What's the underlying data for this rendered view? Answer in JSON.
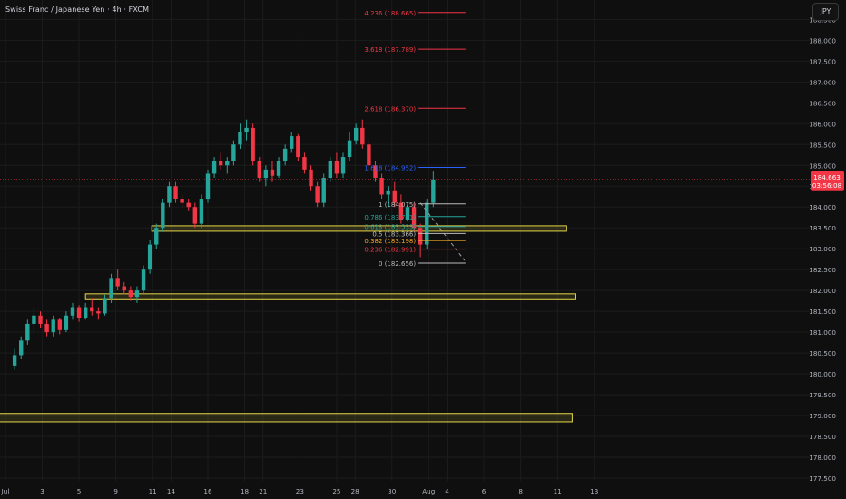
{
  "header": {
    "title": "Swiss Franc / Japanese Yen · 4h · FXCM",
    "currency_button": "JPY"
  },
  "price_tag": {
    "price": "184.663",
    "countdown": "03:56:08",
    "color": "#f23645"
  },
  "colors": {
    "bull": "#26a69a",
    "bear": "#f23645",
    "zone": "#e6d84a",
    "fib_ext": "#f23645",
    "fib_blue": "#2962ff"
  },
  "chart_data": {
    "type": "candlestick",
    "y_axis": {
      "range": [
        177.5,
        188.9
      ],
      "tick_labels": [
        "188.500",
        "188.000",
        "187.500",
        "187.000",
        "186.500",
        "186.000",
        "185.500",
        "185.000",
        "184.500",
        "184.000",
        "183.500",
        "183.000",
        "182.500",
        "182.000",
        "181.500",
        "181.000",
        "180.500",
        "180.000",
        "179.500",
        "179.000",
        "178.500",
        "178.000",
        "177.500"
      ],
      "ticks": [
        188.5,
        188.0,
        187.5,
        187.0,
        186.5,
        186.0,
        185.5,
        185.0,
        184.5,
        184.0,
        183.5,
        183.0,
        182.5,
        182.0,
        181.5,
        181.0,
        180.5,
        180.0,
        179.5,
        179.0,
        178.5,
        178.0,
        177.5
      ]
    },
    "x_axis": {
      "range": [
        1,
        45
      ],
      "tick_labels": [
        "Jul",
        "3",
        "5",
        "9",
        "11",
        "14",
        "16",
        "18",
        "21",
        "23",
        "25",
        "28",
        "30",
        "Aug",
        "4",
        "6",
        "8",
        "11",
        "13"
      ],
      "ticks": [
        1,
        3,
        5,
        7,
        9,
        10,
        12,
        14,
        15,
        17,
        19,
        20,
        22,
        24,
        25,
        27,
        29,
        31,
        33
      ]
    },
    "zones": [
      {
        "x": [
          8.95,
          31.5
        ],
        "y": [
          183.45,
          183.55
        ]
      },
      {
        "x": [
          5.35,
          32.0
        ],
        "y": [
          181.78,
          181.92
        ]
      },
      {
        "x": [
          -0.2,
          31.8
        ],
        "y": [
          178.85,
          179.05
        ]
      }
    ],
    "fib_levels": [
      {
        "label": "4.236 (188.665)",
        "price": 188.665,
        "color": "#f23645"
      },
      {
        "label": "3.618 (187.789)",
        "price": 187.789,
        "color": "#f23645"
      },
      {
        "label": "2.618 (186.370)",
        "price": 186.37,
        "color": "#f23645"
      },
      {
        "label": "1.618 (184.952)",
        "price": 184.952,
        "color": "#2962ff"
      },
      {
        "label": "1 (184.075)",
        "price": 184.075,
        "color": "#bbbbbb"
      },
      {
        "label": "0.786 (183.771)",
        "price": 183.771,
        "color": "#26a69a"
      },
      {
        "label": "0.618 (183.533)",
        "price": 183.533,
        "color": "#26a69a"
      },
      {
        "label": "0.5 (183.366)",
        "price": 183.366,
        "color": "#bbbbbb"
      },
      {
        "label": "0.382 (183.198)",
        "price": 183.198,
        "color": "#f5a623"
      },
      {
        "label": "0.236 (182.991)",
        "price": 182.991,
        "color": "#f23645"
      },
      {
        "label": "0 (182.656)",
        "price": 182.656,
        "color": "#bbbbbb"
      }
    ],
    "trend_line": {
      "from": [
        23.55,
        184.1
      ],
      "to": [
        25.95,
        182.72
      ]
    },
    "current_price": 184.663,
    "candles": [
      {
        "o": 180.2,
        "h": 180.6,
        "l": 180.1,
        "c": 180.45
      },
      {
        "o": 180.45,
        "h": 180.9,
        "l": 180.35,
        "c": 180.8
      },
      {
        "o": 180.8,
        "h": 181.3,
        "l": 180.7,
        "c": 181.2
      },
      {
        "o": 181.2,
        "h": 181.6,
        "l": 181.0,
        "c": 181.4
      },
      {
        "o": 181.4,
        "h": 181.5,
        "l": 181.1,
        "c": 181.2
      },
      {
        "o": 181.2,
        "h": 181.3,
        "l": 180.9,
        "c": 181.0
      },
      {
        "o": 181.0,
        "h": 181.4,
        "l": 180.9,
        "c": 181.3
      },
      {
        "o": 181.3,
        "h": 181.35,
        "l": 180.95,
        "c": 181.05
      },
      {
        "o": 181.05,
        "h": 181.5,
        "l": 181.0,
        "c": 181.4
      },
      {
        "o": 181.4,
        "h": 181.7,
        "l": 181.3,
        "c": 181.6
      },
      {
        "o": 181.6,
        "h": 181.65,
        "l": 181.25,
        "c": 181.35
      },
      {
        "o": 181.35,
        "h": 181.7,
        "l": 181.3,
        "c": 181.6
      },
      {
        "o": 181.6,
        "h": 181.8,
        "l": 181.4,
        "c": 181.5
      },
      {
        "o": 181.5,
        "h": 181.6,
        "l": 181.3,
        "c": 181.45
      },
      {
        "o": 181.45,
        "h": 181.9,
        "l": 181.4,
        "c": 181.8
      },
      {
        "o": 181.8,
        "h": 182.4,
        "l": 181.7,
        "c": 182.3
      },
      {
        "o": 182.3,
        "h": 182.5,
        "l": 182.0,
        "c": 182.1
      },
      {
        "o": 182.1,
        "h": 182.2,
        "l": 181.9,
        "c": 182.0
      },
      {
        "o": 182.0,
        "h": 182.1,
        "l": 181.75,
        "c": 181.85
      },
      {
        "o": 181.85,
        "h": 182.1,
        "l": 181.7,
        "c": 182.0
      },
      {
        "o": 182.0,
        "h": 182.6,
        "l": 181.9,
        "c": 182.5
      },
      {
        "o": 182.5,
        "h": 183.2,
        "l": 182.4,
        "c": 183.1
      },
      {
        "o": 183.1,
        "h": 183.6,
        "l": 183.0,
        "c": 183.5
      },
      {
        "o": 183.5,
        "h": 184.2,
        "l": 183.4,
        "c": 184.1
      },
      {
        "o": 184.1,
        "h": 184.6,
        "l": 184.0,
        "c": 184.5
      },
      {
        "o": 184.5,
        "h": 184.6,
        "l": 184.1,
        "c": 184.2
      },
      {
        "o": 184.2,
        "h": 184.3,
        "l": 184.0,
        "c": 184.1
      },
      {
        "o": 184.1,
        "h": 184.2,
        "l": 183.9,
        "c": 184.0
      },
      {
        "o": 184.0,
        "h": 184.1,
        "l": 183.5,
        "c": 183.6
      },
      {
        "o": 183.6,
        "h": 184.3,
        "l": 183.5,
        "c": 184.2
      },
      {
        "o": 184.2,
        "h": 184.9,
        "l": 184.1,
        "c": 184.8
      },
      {
        "o": 184.8,
        "h": 185.2,
        "l": 184.7,
        "c": 185.1
      },
      {
        "o": 185.1,
        "h": 185.3,
        "l": 184.9,
        "c": 185.0
      },
      {
        "o": 185.0,
        "h": 185.2,
        "l": 184.8,
        "c": 185.1
      },
      {
        "o": 185.1,
        "h": 185.6,
        "l": 185.0,
        "c": 185.5
      },
      {
        "o": 185.5,
        "h": 186.0,
        "l": 185.4,
        "c": 185.8
      },
      {
        "o": 185.8,
        "h": 186.1,
        "l": 185.6,
        "c": 185.9
      },
      {
        "o": 185.9,
        "h": 186.0,
        "l": 185.0,
        "c": 185.1
      },
      {
        "o": 185.1,
        "h": 185.2,
        "l": 184.6,
        "c": 184.7
      },
      {
        "o": 184.7,
        "h": 185.0,
        "l": 184.5,
        "c": 184.9
      },
      {
        "o": 184.9,
        "h": 185.1,
        "l": 184.6,
        "c": 184.75
      },
      {
        "o": 184.75,
        "h": 185.2,
        "l": 184.7,
        "c": 185.1
      },
      {
        "o": 185.1,
        "h": 185.5,
        "l": 185.0,
        "c": 185.4
      },
      {
        "o": 185.4,
        "h": 185.8,
        "l": 185.3,
        "c": 185.7
      },
      {
        "o": 185.7,
        "h": 185.75,
        "l": 185.1,
        "c": 185.2
      },
      {
        "o": 185.2,
        "h": 185.3,
        "l": 184.8,
        "c": 184.9
      },
      {
        "o": 184.9,
        "h": 185.0,
        "l": 184.4,
        "c": 184.5
      },
      {
        "o": 184.5,
        "h": 184.6,
        "l": 184.0,
        "c": 184.1
      },
      {
        "o": 184.1,
        "h": 184.8,
        "l": 184.0,
        "c": 184.7
      },
      {
        "o": 184.7,
        "h": 185.2,
        "l": 184.6,
        "c": 185.1
      },
      {
        "o": 185.1,
        "h": 185.3,
        "l": 184.7,
        "c": 184.8
      },
      {
        "o": 184.8,
        "h": 185.3,
        "l": 184.7,
        "c": 185.2
      },
      {
        "o": 185.2,
        "h": 185.8,
        "l": 185.1,
        "c": 185.6
      },
      {
        "o": 185.6,
        "h": 186.0,
        "l": 185.5,
        "c": 185.9
      },
      {
        "o": 185.9,
        "h": 186.1,
        "l": 185.4,
        "c": 185.5
      },
      {
        "o": 185.5,
        "h": 185.6,
        "l": 184.9,
        "c": 185.0
      },
      {
        "o": 185.0,
        "h": 185.1,
        "l": 184.6,
        "c": 184.7
      },
      {
        "o": 184.7,
        "h": 184.8,
        "l": 184.2,
        "c": 184.3
      },
      {
        "o": 184.3,
        "h": 184.5,
        "l": 184.0,
        "c": 184.4
      },
      {
        "o": 184.4,
        "h": 184.6,
        "l": 184.0,
        "c": 184.1
      },
      {
        "o": 184.1,
        "h": 184.3,
        "l": 183.6,
        "c": 183.7
      },
      {
        "o": 183.7,
        "h": 184.1,
        "l": 183.65,
        "c": 184.0
      },
      {
        "o": 184.0,
        "h": 184.1,
        "l": 183.4,
        "c": 183.5
      },
      {
        "o": 183.5,
        "h": 183.6,
        "l": 182.8,
        "c": 183.1
      },
      {
        "o": 183.1,
        "h": 184.2,
        "l": 183.0,
        "c": 184.1
      },
      {
        "o": 184.1,
        "h": 184.85,
        "l": 184.0,
        "c": 184.663
      }
    ]
  }
}
